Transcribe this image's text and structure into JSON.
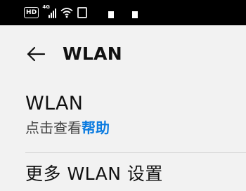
{
  "status_bar": {
    "hd_label": "HD",
    "network_label": "4G",
    "icons": [
      "hd-badge",
      "cellular-signal-icon",
      "wifi-icon",
      "status-extra-icon"
    ]
  },
  "header": {
    "title": "WLAN",
    "back_icon": "arrow-left-icon"
  },
  "wlan_row": {
    "title": "WLAN",
    "subtitle_prefix": "点击查看",
    "subtitle_link": "帮助"
  },
  "more_row": {
    "label": "更多 WLAN 设置"
  },
  "colors": {
    "status_bar_bg": "#000000",
    "page_bg": "#f2f2f2",
    "link": "#0a7be0"
  }
}
